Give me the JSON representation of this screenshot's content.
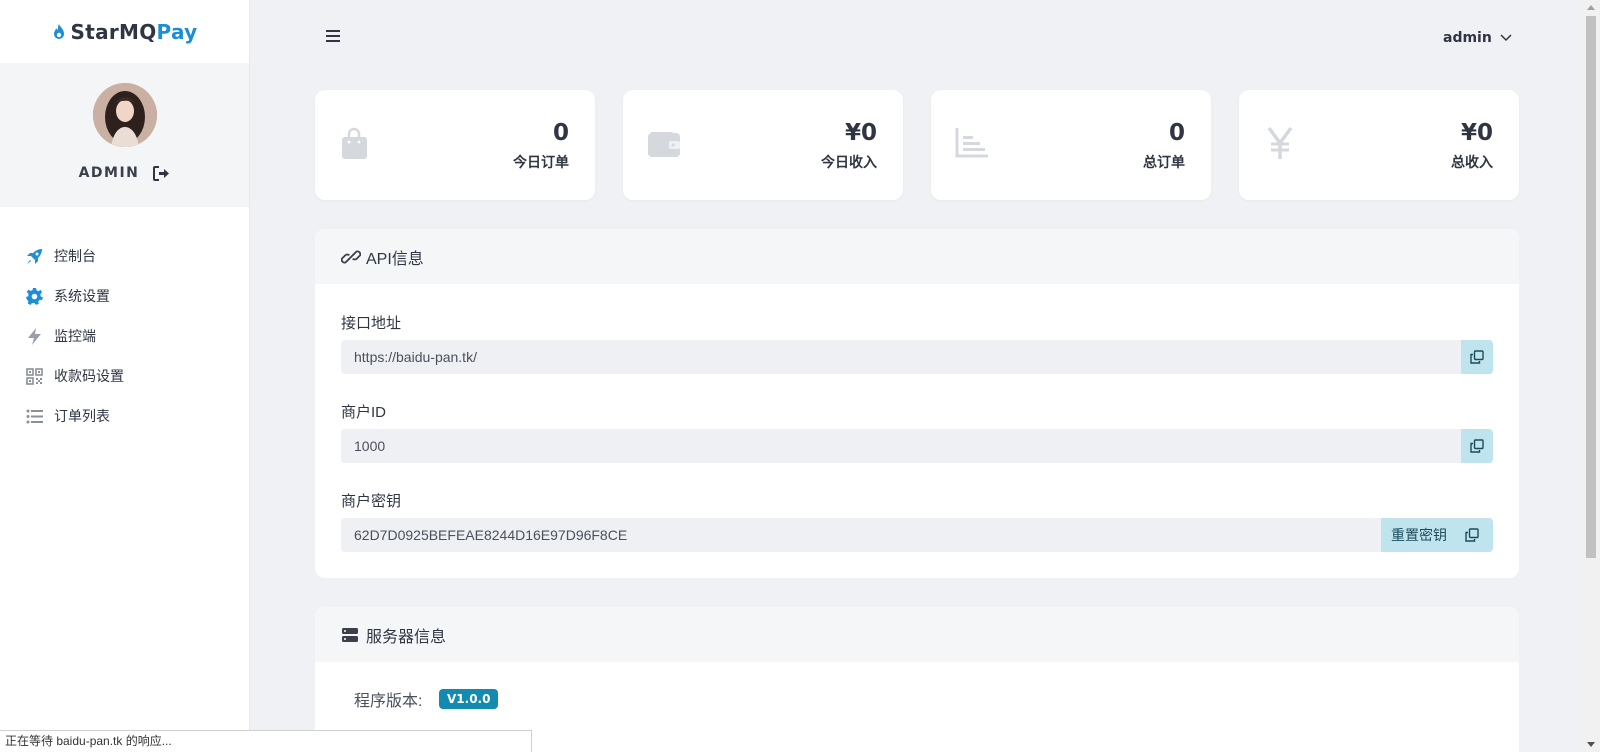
{
  "brand": {
    "part1": "StarMQ",
    "part2": "Pay",
    "accent": "#1b8ed6"
  },
  "profile": {
    "username": "ADMIN"
  },
  "nav": [
    {
      "label": "控制台",
      "icon": "rocket-icon"
    },
    {
      "label": "系统设置",
      "icon": "gear-icon"
    },
    {
      "label": "监控端",
      "icon": "bolt-icon"
    },
    {
      "label": "收款码设置",
      "icon": "qrcode-icon"
    },
    {
      "label": "订单列表",
      "icon": "list-icon"
    }
  ],
  "topbar": {
    "user": "admin"
  },
  "stats": [
    {
      "value": "0",
      "label": "今日订单",
      "icon": "shopping-bag-icon"
    },
    {
      "value": "¥0",
      "label": "今日收入",
      "icon": "wallet-icon"
    },
    {
      "value": "0",
      "label": "总订单",
      "icon": "chart-icon"
    },
    {
      "value": "¥0",
      "label": "总收入",
      "icon": "yen-icon"
    }
  ],
  "api": {
    "title": "API信息",
    "url_label": "接口地址",
    "url_value": "https://baidu-pan.tk/",
    "mid_label": "商户ID",
    "mid_value": "1000",
    "key_label": "商户密钥",
    "key_value": "62D7D0925BEFEAE8244D16E97D96F8CE",
    "reset_label": "重置密钥"
  },
  "server": {
    "title": "服务器信息",
    "version_label": "程序版本:",
    "version_value": "V1.0.0",
    "badge_color": "#138bb0"
  },
  "status_bar": "正在等待 baidu-pan.tk 的响应..."
}
